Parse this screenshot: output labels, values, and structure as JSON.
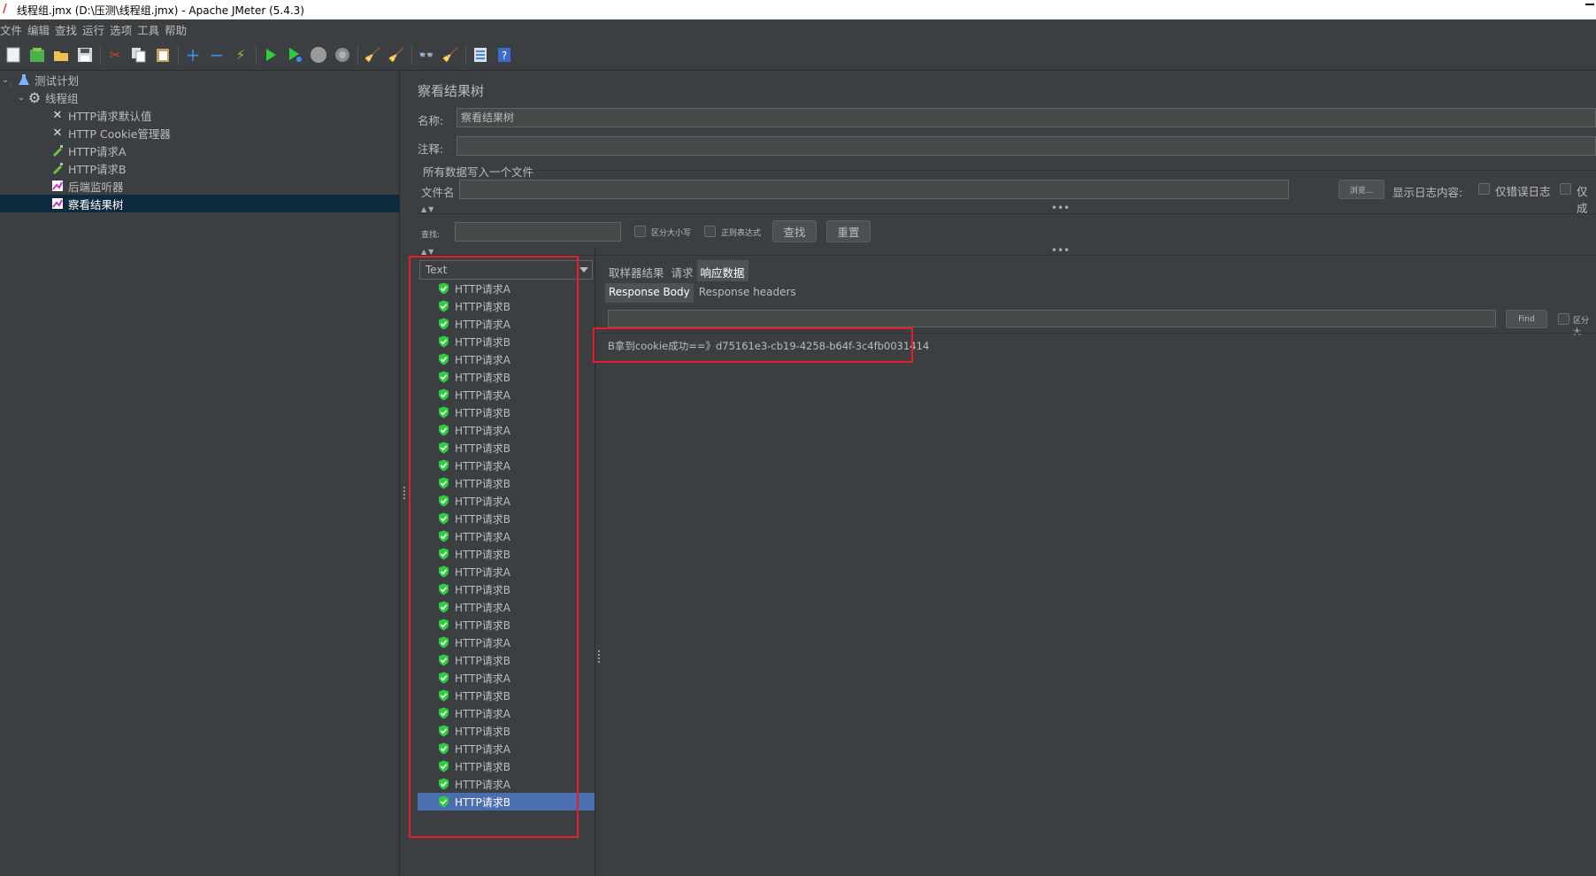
{
  "window": {
    "title": "线程组.jmx (D:\\压测\\线程组.jmx) - Apache JMeter (5.4.3)"
  },
  "menu": [
    "文件",
    "编辑",
    "查找",
    "运行",
    "选项",
    "工具",
    "帮助"
  ],
  "tree": {
    "root": "测试计划",
    "thread_group": "线程组",
    "children": [
      "HTTP请求默认值",
      "HTTP Cookie管理器",
      "HTTP请求A",
      "HTTP请求B",
      "后端监听器",
      "察看结果树"
    ]
  },
  "panel": {
    "title": "察看结果树",
    "name_label": "名称:",
    "name_value": "察看结果树",
    "comment_label": "注释:",
    "comment_value": "",
    "section_label": "所有数据写入一个文件",
    "filename_label": "文件名",
    "filename_value": "",
    "browse_label": "浏览...",
    "log_label": "显示日志内容:",
    "errors_only_label": "仅错误日志",
    "success_only_label": "仅成",
    "search_label": "查找:",
    "search_value": "",
    "case_label": "区分大小写",
    "regex_label": "正则表达式",
    "find_label": "查找",
    "reset_label": "重置"
  },
  "renderer": {
    "selected": "Text"
  },
  "results": [
    "HTTP请求A",
    "HTTP请求B",
    "HTTP请求A",
    "HTTP请求B",
    "HTTP请求A",
    "HTTP请求B",
    "HTTP请求A",
    "HTTP请求B",
    "HTTP请求A",
    "HTTP请求B",
    "HTTP请求A",
    "HTTP请求B",
    "HTTP请求A",
    "HTTP请求B",
    "HTTP请求A",
    "HTTP请求B",
    "HTTP请求A",
    "HTTP请求B",
    "HTTP请求A",
    "HTTP请求B",
    "HTTP请求A",
    "HTTP请求B",
    "HTTP请求A",
    "HTTP请求B",
    "HTTP请求A",
    "HTTP请求B",
    "HTTP请求A",
    "HTTP请求B",
    "HTTP请求A",
    "HTTP请求B"
  ],
  "detail": {
    "tabs": [
      "取样器结果",
      "请求",
      "响应数据"
    ],
    "active_tab": "响应数据",
    "subtabs": [
      "Response Body",
      "Response headers"
    ],
    "active_subtab": "Response Body",
    "find_value": "",
    "find_button": "Find",
    "case_label": "区分大",
    "response_body": "B拿到cookie成功==》d75161e3-cb19-4258-b64f-3c4fb0031414"
  },
  "colors": {
    "background": "#3c3f41",
    "selection": "#4b6eaf",
    "tree_selection": "#0d293e",
    "highlight_box": "#e81c2a",
    "success": "#2ecc40"
  }
}
